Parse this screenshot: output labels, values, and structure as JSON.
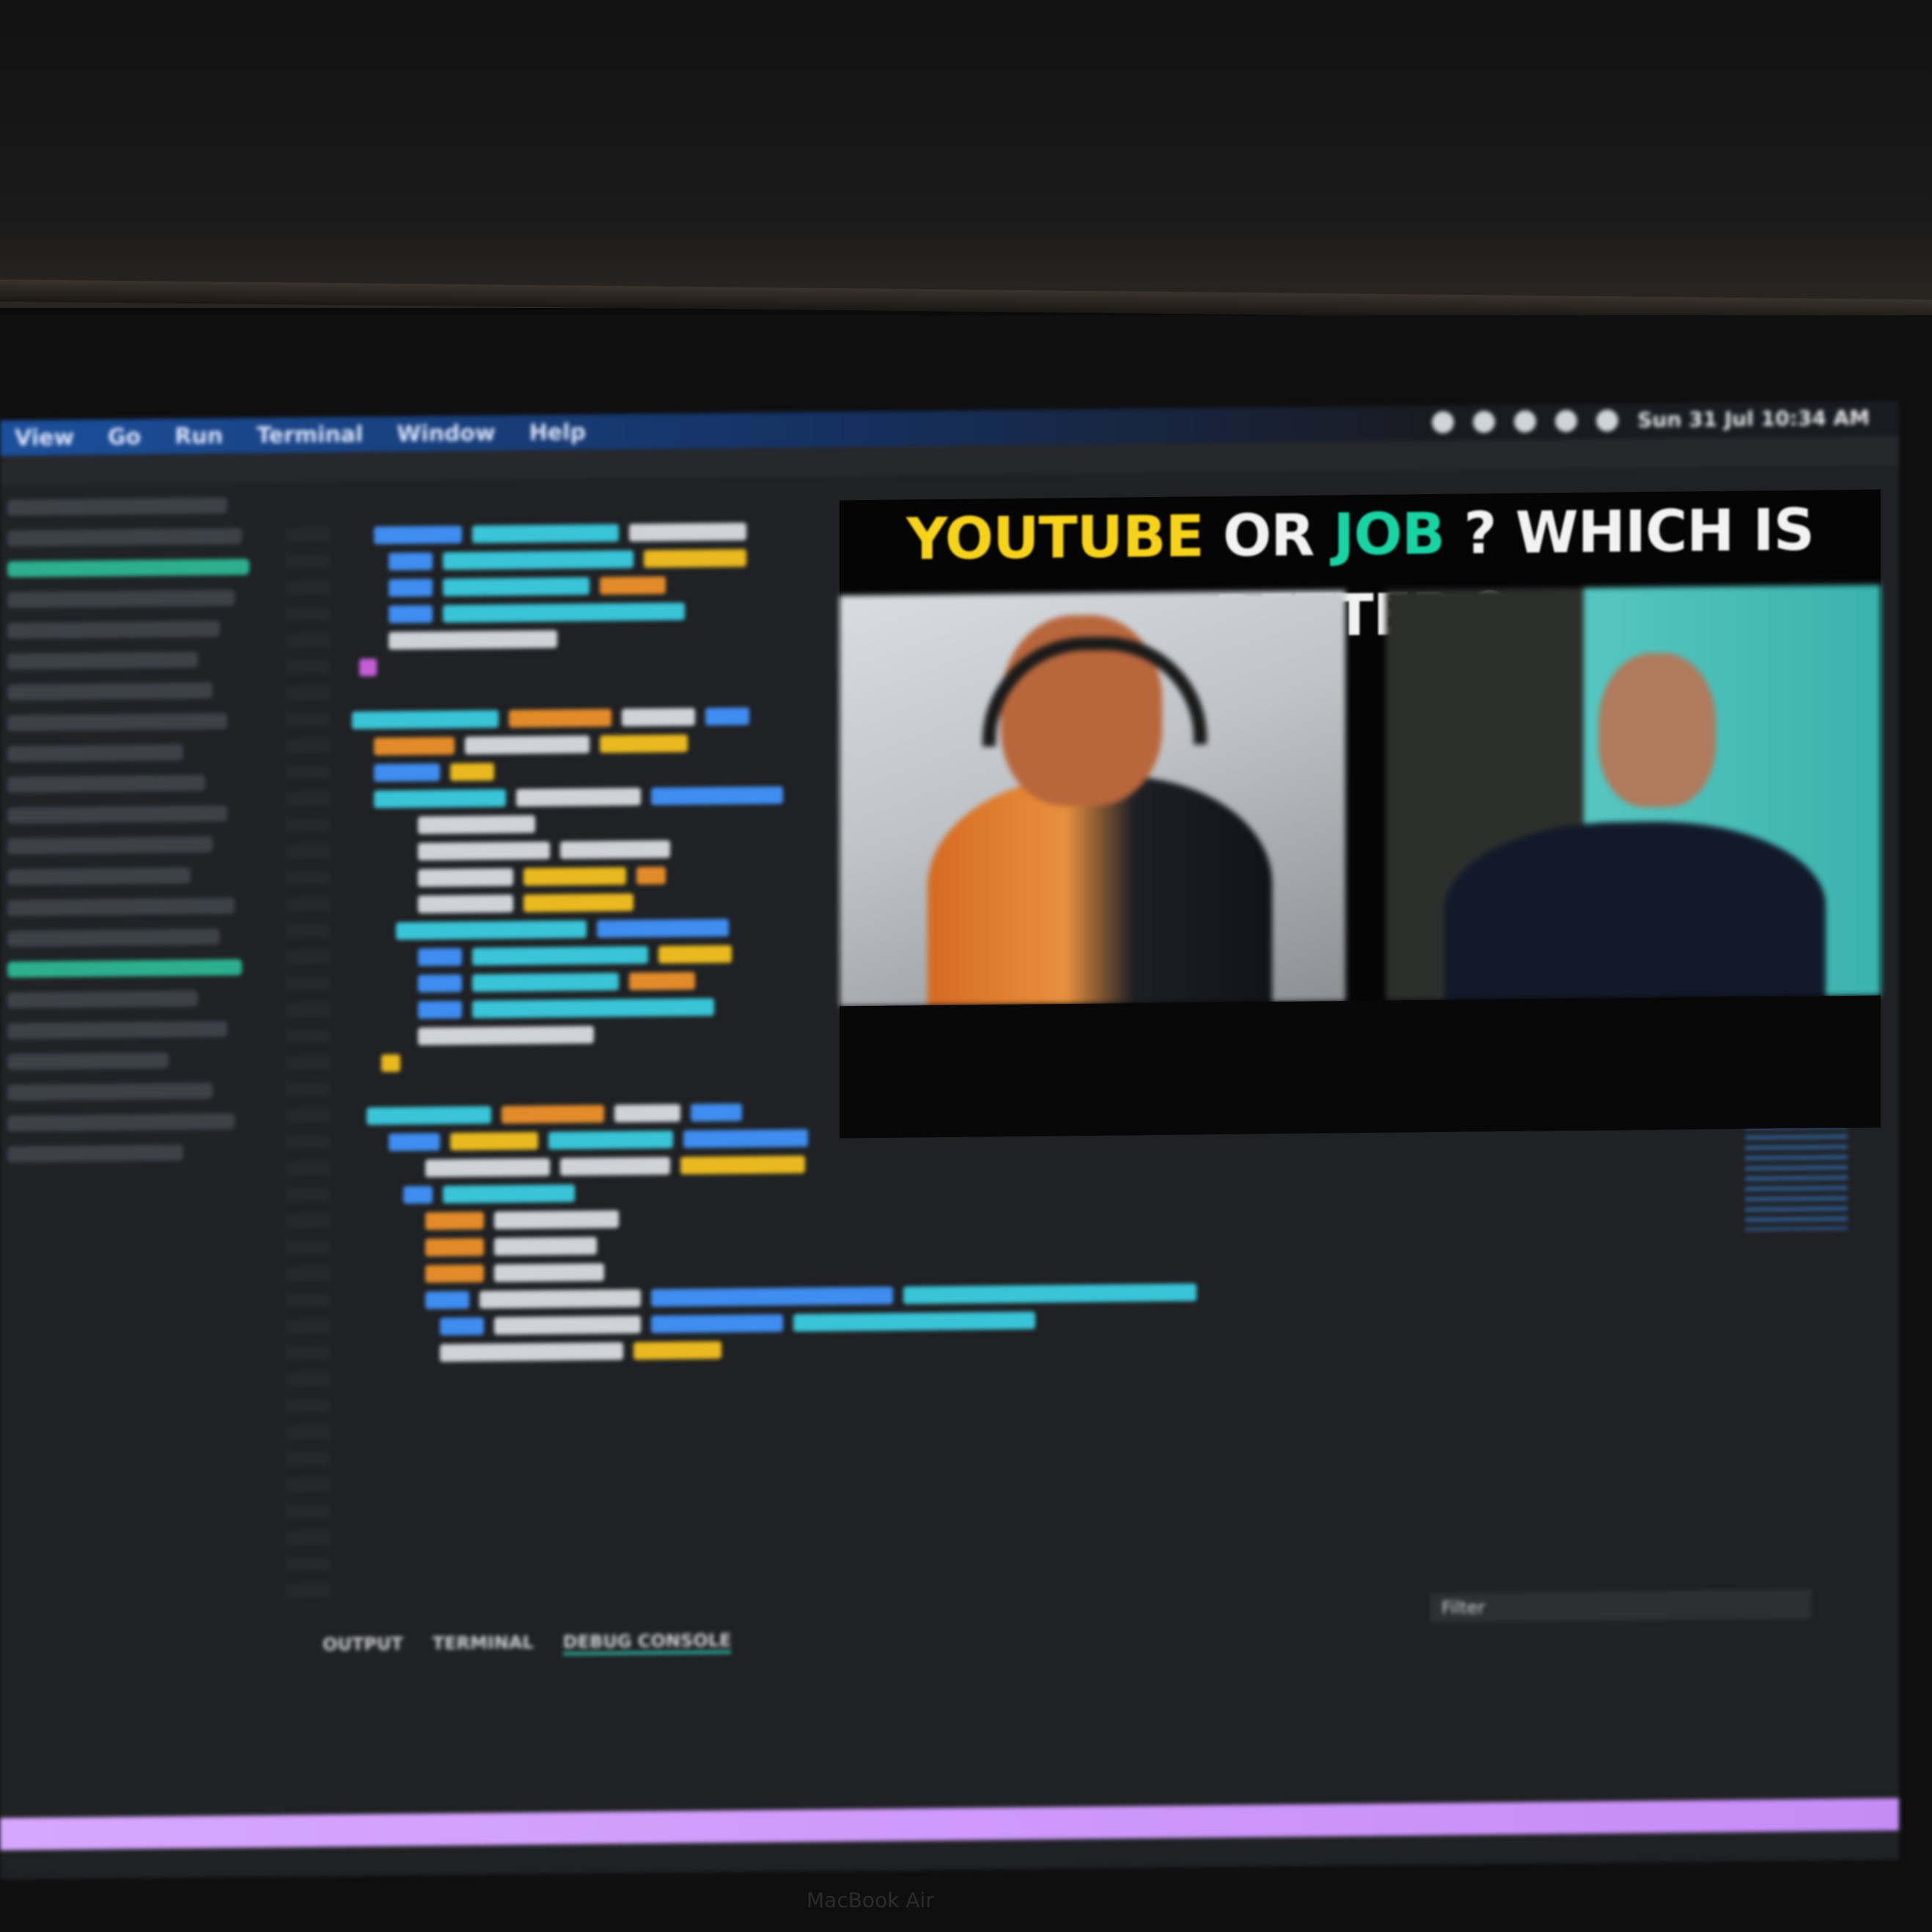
{
  "macos_menu": {
    "items": [
      "View",
      "Go",
      "Run",
      "Terminal",
      "Window",
      "Help"
    ],
    "clock": "Sun 31 Jul 10:34 AM"
  },
  "editor": {
    "panel_tabs": [
      "OUTPUT",
      "TERMINAL",
      "DEBUG CONSOLE"
    ],
    "active_tab": "DEBUG CONSOLE",
    "filter_placeholder": "Filter"
  },
  "video_overlay": {
    "headline": {
      "word1": "YOUTUBE",
      "word2": "OR",
      "word3": "JOB",
      "word4": "? WHICH IS BETTER ?"
    },
    "colors": {
      "word1": "#f7d21b",
      "word3": "#19d3a3",
      "rest": "#f2f2f2"
    }
  },
  "device_label": "MacBook Air"
}
